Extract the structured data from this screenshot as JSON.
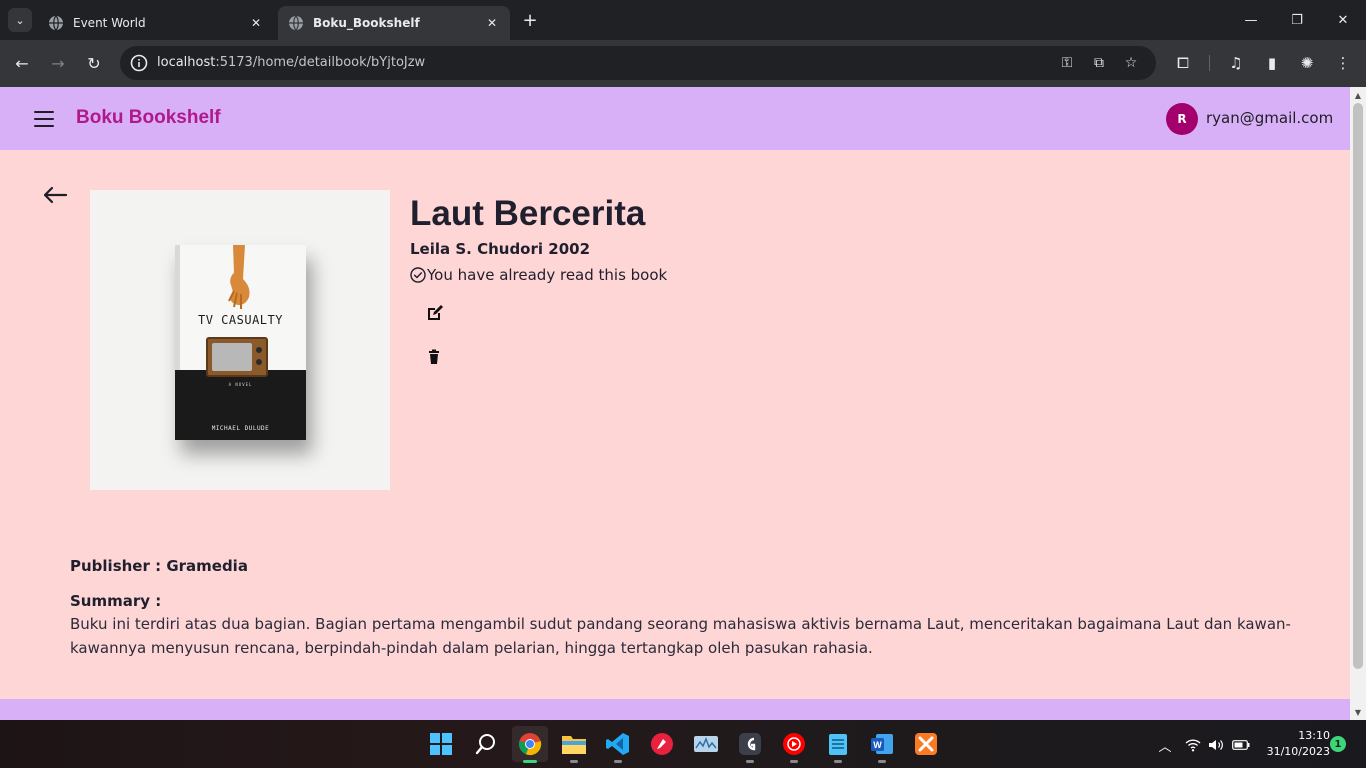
{
  "browser": {
    "tabs": [
      {
        "title": "Event World",
        "active": false
      },
      {
        "title": "Boku_Bookshelf",
        "active": true
      }
    ],
    "url_host": "localhost",
    "url_path": ":5173/home/detailbook/bYjtoJzw"
  },
  "app": {
    "brand": "Boku Bookshelf",
    "user_initial": "R",
    "user_email": "ryan@gmail.com",
    "colors": {
      "header": "#d8b0f7",
      "background": "#ffd6d6",
      "brand": "#b0198c",
      "avatar": "#a3006e"
    }
  },
  "book": {
    "title": "Laut Bercerita",
    "meta": "Leila S. Chudori 2002",
    "read_status": "You have already read this book",
    "cover": {
      "title": "TV CASUALTY",
      "subtitle": "A NOVEL",
      "author": "MICHAEL DULUDE"
    },
    "publisher_text": "Publisher : Gramedia",
    "summary_label": "Summary :",
    "summary": "Buku ini terdiri atas dua bagian. Bagian pertama mengambil sudut pandang seorang mahasiswa aktivis bernama Laut, menceritakan bagaimana Laut dan kawan-kawannya menyusun rencana, berpindah-pindah dalam pelarian, hingga tertangkap oleh pasukan rahasia."
  },
  "taskbar": {
    "apps": [
      "windows-start",
      "search",
      "chrome",
      "file-explorer",
      "vscode",
      "git-tool",
      "monitor",
      "github-desktop",
      "youtube-music",
      "notepad",
      "word",
      "xampp"
    ],
    "time": "13:10",
    "date": "31/10/2023",
    "notifications": "1"
  }
}
